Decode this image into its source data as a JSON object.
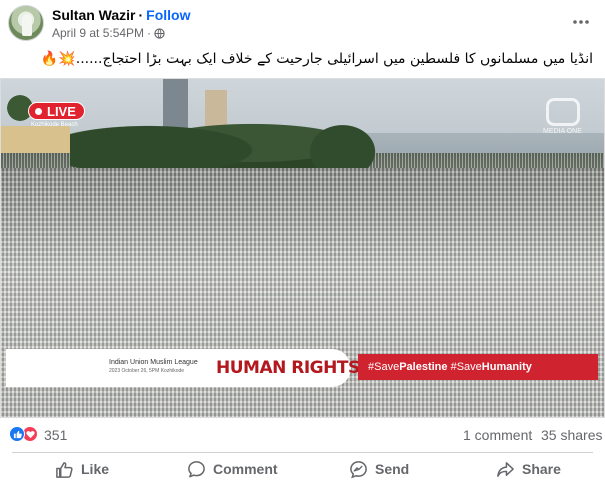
{
  "post": {
    "author": "Sultan Wazir",
    "separator": "·",
    "follow_label": "Follow",
    "timestamp": "April 9 at 5:54PM",
    "timestamp_dot": "·",
    "caption": "انڈیا میں مسلمانوں کا فلسطین میں اسرائیلی جارحیت کے خلاف ایک بہت بڑا احتجاج......💥🔥"
  },
  "video": {
    "live_label": "LIVE",
    "live_location": "Kozhikode Beach",
    "watermark": "MEDIA ONE",
    "lower_third": {
      "org": "Indian Union Muslim League",
      "org_sub": "2023 October 26, 5PM Kozhikode",
      "title": "HUMAN RIGHTS RALLY"
    },
    "hashtags": {
      "tag1_prefix": "#Save",
      "tag1_bold": "Palestine",
      "tag2_prefix": "#Save",
      "tag2_bold": "Humanity"
    }
  },
  "stats": {
    "reactions_count": "351",
    "comments": "1 comment",
    "shares": "35 shares"
  },
  "actions": {
    "like": "Like",
    "comment": "Comment",
    "send": "Send",
    "share": "Share"
  },
  "colors": {
    "accent": "#0866ff",
    "like_reaction": "#1877f2",
    "love_reaction": "#f33e58",
    "live_red": "#e0232e",
    "hashtag_bar": "#cf2430",
    "title_red": "#b3181f"
  },
  "icons": [
    "globe-icon",
    "more-options-icon",
    "like-reaction-icon",
    "love-reaction-icon",
    "thumbs-up-icon",
    "comment-icon",
    "send-icon",
    "share-icon"
  ]
}
